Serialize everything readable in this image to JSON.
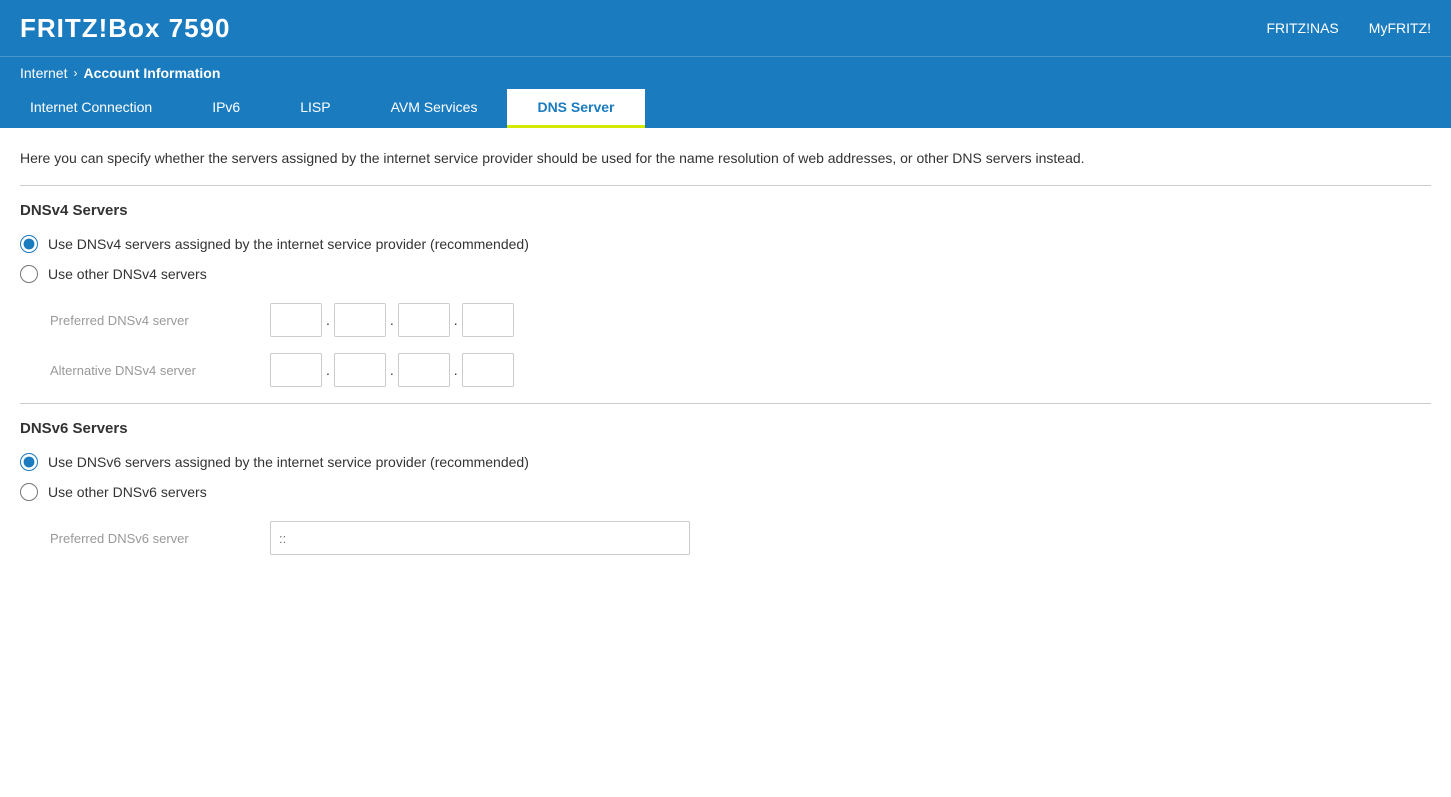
{
  "header": {
    "logo": "FRITZ!Box 7590",
    "nav_links": [
      {
        "label": "FRITZ!NAS",
        "id": "fritz-nas"
      },
      {
        "label": "MyFRITZ!",
        "id": "my-fritz"
      }
    ]
  },
  "breadcrumb": {
    "parent": "Internet",
    "separator": "›",
    "current": "Account Information"
  },
  "tabs": [
    {
      "label": "Internet Connection",
      "id": "tab-internet-connection",
      "active": false
    },
    {
      "label": "IPv6",
      "id": "tab-ipv6",
      "active": false
    },
    {
      "label": "LISP",
      "id": "tab-lisp",
      "active": false
    },
    {
      "label": "AVM Services",
      "id": "tab-avm-services",
      "active": false
    },
    {
      "label": "DNS Server",
      "id": "tab-dns-server",
      "active": true
    }
  ],
  "description": "Here you can specify whether the servers assigned by the internet service provider should be used for the name resolution of web addresses, or other DNS servers instead.",
  "dnsv4": {
    "section_title": "DNSv4 Servers",
    "options": [
      {
        "id": "dnsv4-isp",
        "label": "Use DNSv4 servers assigned by the internet service provider (recommended)",
        "checked": true
      },
      {
        "id": "dnsv4-other",
        "label": "Use other DNSv4 servers",
        "checked": false
      }
    ],
    "preferred_label": "Preferred DNSv4 server",
    "alternative_label": "Alternative DNSv4 server"
  },
  "dnsv6": {
    "section_title": "DNSv6 Servers",
    "options": [
      {
        "id": "dnsv6-isp",
        "label": "Use DNSv6 servers assigned by the internet service provider (recommended)",
        "checked": true
      },
      {
        "id": "dnsv6-other",
        "label": "Use other DNSv6 servers",
        "checked": false
      }
    ],
    "preferred_label": "Preferred DNSv6 server",
    "ipv6_placeholder": "::"
  }
}
